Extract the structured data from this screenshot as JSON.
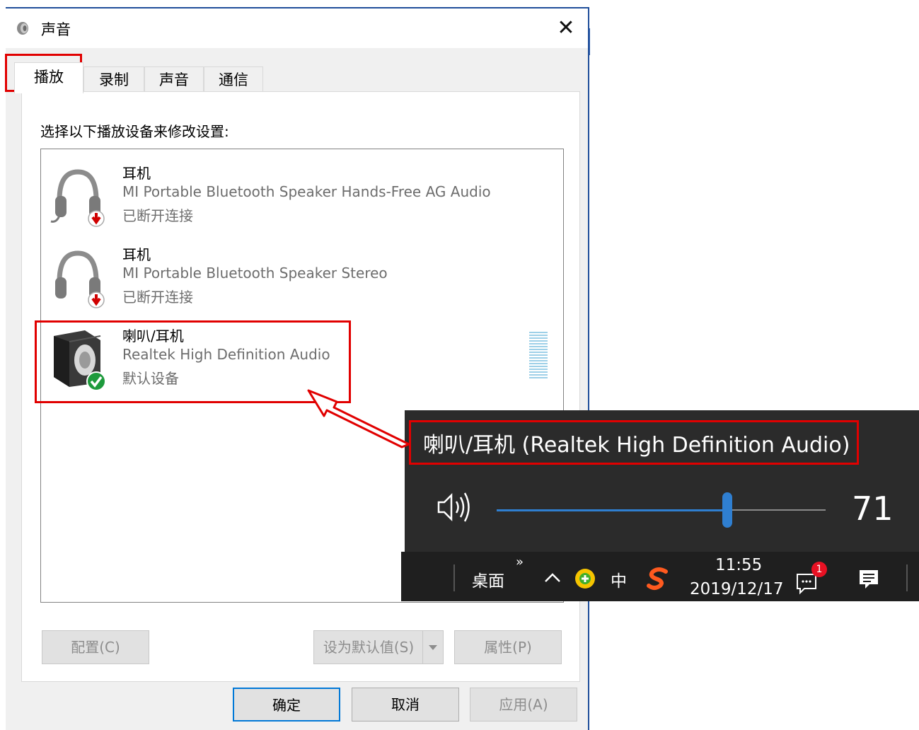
{
  "dialog": {
    "title": "声音",
    "close": "✕",
    "tabs": [
      {
        "label": "播放"
      },
      {
        "label": "录制"
      },
      {
        "label": "声音"
      },
      {
        "label": "通信"
      }
    ],
    "instruction": "选择以下播放设备来修改设置:",
    "devices": [
      {
        "name": "耳机",
        "description": "MI Portable Bluetooth Speaker Hands-Free AG Audio",
        "status": "已断开连接",
        "icon": "headphones-disconnected-icon"
      },
      {
        "name": "耳机",
        "description": "MI Portable Bluetooth Speaker Stereo",
        "status": "已断开连接",
        "icon": "headphones-disconnected-icon"
      },
      {
        "name": "喇叭/耳机",
        "description": "Realtek High Definition Audio",
        "status": "默认设备",
        "icon": "speaker-default-icon"
      }
    ],
    "buttons": {
      "configure": "配置(C)",
      "set_default": "设为默认值(S)",
      "properties": "属性(P)",
      "ok": "确定",
      "cancel": "取消",
      "apply": "应用(A)"
    }
  },
  "flyout": {
    "device_title": "喇叭/耳机 (Realtek High Definition Audio)",
    "volume": 71,
    "volume_label": "71"
  },
  "taskbar": {
    "desktop": "桌面",
    "overflow": "»",
    "ime": "中",
    "time": "11:55",
    "date": "2019/12/17",
    "notification_badge": "1"
  },
  "colors": {
    "accent": "#0078d7",
    "annotation": "#e10000",
    "flyout_bg": "#2b2b2b",
    "taskbar_bg": "#1f1f1f"
  }
}
